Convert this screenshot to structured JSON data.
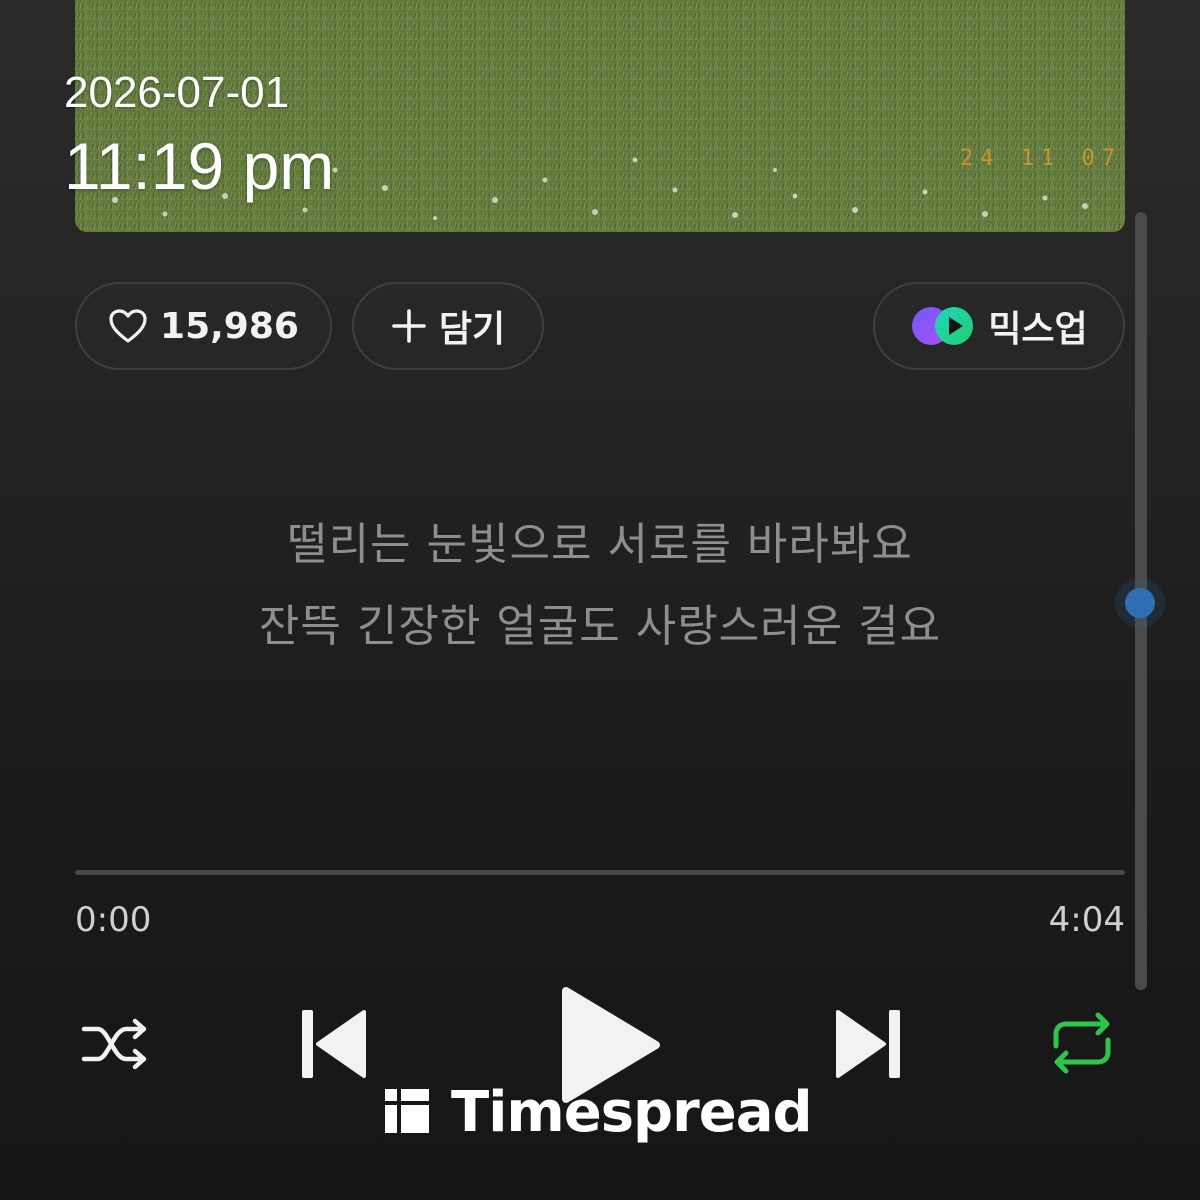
{
  "album_art": {
    "photo_stamp": "24 11 07"
  },
  "overlay": {
    "date": "2026-07-01",
    "time": "11:19 pm"
  },
  "actions": {
    "like_count": "15,986",
    "add_label": "담기",
    "mixup_label": "믹스업"
  },
  "lyrics": [
    "떨리는 눈빛으로 서로를 바라봐요",
    "잔뜩 긴장한 얼굴도 사랑스러운 걸요"
  ],
  "playback": {
    "elapsed": "0:00",
    "total": "4:04",
    "progress_fraction": 0,
    "shuffle_on": false,
    "repeat_on": true
  },
  "colors": {
    "accent_green": "#2fc54b",
    "scroll_thumb": "#2f6fb3"
  },
  "icons": {
    "like": "heart-outline-icon",
    "add": "plus-icon",
    "mixup": "mixup-logo-icon",
    "shuffle": "shuffle-icon",
    "prev": "skip-previous-icon",
    "play": "play-icon",
    "next": "skip-next-icon",
    "repeat": "repeat-icon",
    "watermark": "timespread-logo-icon"
  },
  "watermark": {
    "text": "Timespread"
  }
}
